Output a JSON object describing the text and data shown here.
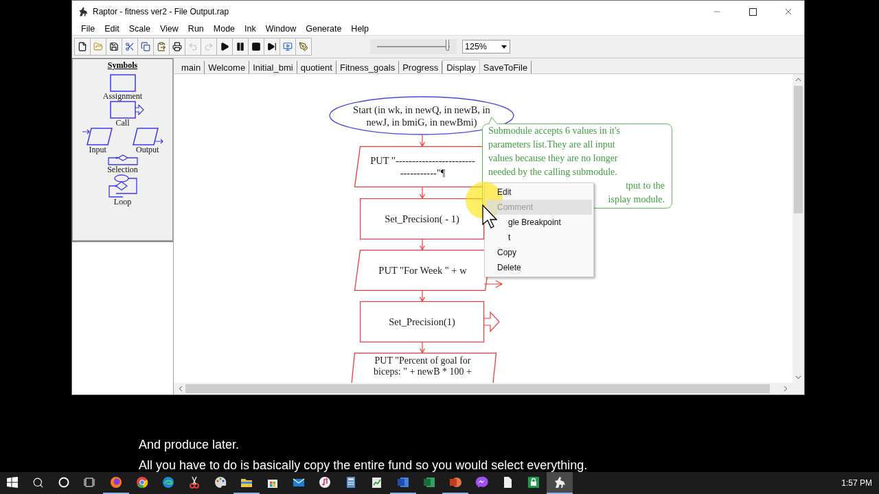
{
  "window": {
    "title": "Raptor - fitness ver2 - File Output.rap"
  },
  "menu": [
    "File",
    "Edit",
    "Scale",
    "View",
    "Run",
    "Mode",
    "Ink",
    "Window",
    "Generate",
    "Help"
  ],
  "toolbar": {
    "buttons": [
      {
        "kind": "new",
        "disabled": false
      },
      {
        "kind": "open",
        "disabled": false
      },
      {
        "kind": "save",
        "disabled": false
      },
      {
        "kind": "cut",
        "disabled": false
      },
      {
        "kind": "copy",
        "disabled": false
      },
      {
        "kind": "paste",
        "disabled": false
      },
      {
        "kind": "print",
        "disabled": false
      },
      {
        "kind": "undo",
        "disabled": true
      },
      {
        "kind": "redo",
        "disabled": true
      },
      {
        "kind": "run",
        "disabled": false
      },
      {
        "kind": "pause",
        "disabled": false
      },
      {
        "kind": "stop",
        "disabled": false
      },
      {
        "kind": "step",
        "disabled": false
      },
      {
        "kind": "compiled",
        "disabled": false
      },
      {
        "kind": "pen",
        "disabled": false
      }
    ],
    "zoom_slider": {
      "level": 0.97
    },
    "zoom": "125%"
  },
  "symbols": {
    "title": "Symbols",
    "items": [
      {
        "kind": "assignment",
        "label": "Assignment"
      },
      {
        "kind": "call",
        "label": "Call"
      },
      {
        "kind": "input",
        "label": "Input"
      },
      {
        "kind": "output",
        "label": "Output"
      },
      {
        "kind": "selection",
        "label": "Selection"
      },
      {
        "kind": "loop",
        "label": "Loop"
      }
    ]
  },
  "tabs": [
    {
      "label": "main",
      "selected": false
    },
    {
      "label": "Welcome",
      "selected": false
    },
    {
      "label": "Initial_bmi",
      "selected": false
    },
    {
      "label": "quotient",
      "selected": false
    },
    {
      "label": "Fitness_goals",
      "selected": false
    },
    {
      "label": "Progress",
      "selected": false
    },
    {
      "label": "Display",
      "selected": true
    },
    {
      "label": "SaveToFile",
      "selected": false
    }
  ],
  "flowchart": {
    "nodes": [
      {
        "kind": "start",
        "selected": false,
        "lines": [
          "Start (in wk, in newQ, in newB, in",
          "newJ, in bmiG, in newBmi)"
        ]
      },
      {
        "kind": "output",
        "selected": true,
        "lines": [
          "PUT \"------------------------",
          "-----------\"¶"
        ]
      },
      {
        "kind": "call",
        "selected": true,
        "lines": [
          "Set_Precision( - 1)"
        ]
      },
      {
        "kind": "output",
        "selected": true,
        "lines": [
          "PUT \"For Week \" + w"
        ]
      },
      {
        "kind": "call",
        "selected": true,
        "lines": [
          "Set_Precision(1)"
        ]
      },
      {
        "kind": "output",
        "selected": true,
        "lines": [
          "PUT \"Percent of goal for",
          "biceps: \" + newB * 100 +"
        ]
      }
    ],
    "comment": {
      "lines": [
        "Submodule accepts 6 values in it's",
        "parameters list.They are all input",
        "values because they are no longer",
        "needed by the calling submodule."
      ],
      "partial_lines": [
        "tput to the",
        "isplay module."
      ]
    }
  },
  "context_menu": {
    "items": [
      {
        "label": "Edit",
        "disabled": false,
        "highlighted": false,
        "covered": false
      },
      {
        "label": "Comment",
        "disabled": true,
        "highlighted": true,
        "covered": false
      },
      {
        "label": "gle Breakpoint",
        "disabled": false,
        "highlighted": false,
        "covered": true
      },
      {
        "label": "t",
        "disabled": false,
        "highlighted": false,
        "covered": true
      },
      {
        "label": "Copy",
        "disabled": false,
        "highlighted": false,
        "covered": false
      },
      {
        "label": "Delete",
        "disabled": false,
        "highlighted": false,
        "covered": false
      }
    ]
  },
  "captions": [
    "And produce later.",
    "All you have to do is basically copy the entire fund so you would select everything."
  ],
  "taskbar": {
    "apps": [
      {
        "kind": "firefox",
        "running": true,
        "selected": false
      },
      {
        "kind": "chrome",
        "running": false,
        "selected": false
      },
      {
        "kind": "edge",
        "running": false,
        "selected": false
      },
      {
        "kind": "snip",
        "running": false,
        "selected": false
      },
      {
        "kind": "paint",
        "running": false,
        "selected": false
      },
      {
        "kind": "explorer",
        "running": true,
        "selected": false
      },
      {
        "kind": "store",
        "running": false,
        "selected": false
      },
      {
        "kind": "mail",
        "running": false,
        "selected": false
      },
      {
        "kind": "music",
        "running": false,
        "selected": false
      },
      {
        "kind": "calculator",
        "running": false,
        "selected": false
      },
      {
        "kind": "notepad",
        "running": false,
        "selected": false
      },
      {
        "kind": "word",
        "running": true,
        "selected": false
      },
      {
        "kind": "excel",
        "running": false,
        "selected": false
      },
      {
        "kind": "powerpoint",
        "running": true,
        "selected": false
      },
      {
        "kind": "messenger",
        "running": false,
        "selected": false
      },
      {
        "kind": "file",
        "running": false,
        "selected": false
      },
      {
        "kind": "greenapp",
        "running": false,
        "selected": false
      },
      {
        "kind": "raptor",
        "running": true,
        "selected": true
      }
    ],
    "clock": "1:57 PM"
  }
}
